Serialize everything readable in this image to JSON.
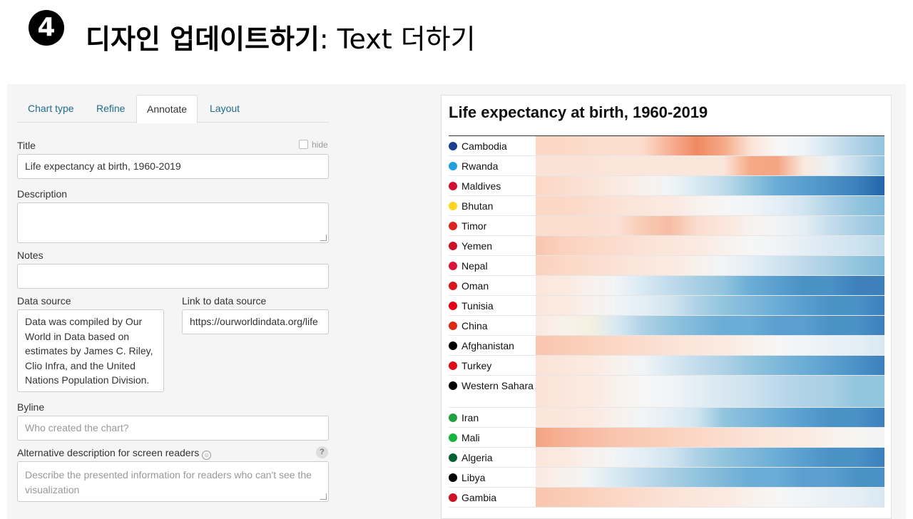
{
  "slide": {
    "step_number": "4",
    "title_bold": "디자인 업데이트하기",
    "title_rest": ": Text 더하기"
  },
  "editor": {
    "tabs": [
      {
        "label": "Chart type",
        "active": false
      },
      {
        "label": "Refine",
        "active": false
      },
      {
        "label": "Annotate",
        "active": true
      },
      {
        "label": "Layout",
        "active": false
      }
    ],
    "title_label": "Title",
    "hide_label": "hide",
    "title_value": "Life expectancy at birth, 1960-2019",
    "description_label": "Description",
    "description_value": "",
    "notes_label": "Notes",
    "notes_value": "",
    "data_source_label": "Data source",
    "data_source_value": "Data was compiled by Our World in Data based on estimates by James C. Riley, Clio Infra, and the United Nations Population Division.",
    "link_label": "Link to data source",
    "link_value": "https://ourworldindata.org/life",
    "byline_label": "Byline",
    "byline_placeholder": "Who created the chart?",
    "alt_label": "Alternative description for screen readers",
    "alt_placeholder": "Describe the presented information for readers who can't see the visualization",
    "help_glyph": "?"
  },
  "chart": {
    "title": "Life expectancy at birth, 1960-2019",
    "rows": [
      {
        "name": "Cambodia",
        "flag": "#1b3f94",
        "colors": [
          "#fbd7c6",
          "#fbd7c6",
          "#fbdccd",
          "#fbdccd",
          "#fbdccd",
          "#f7b095",
          "#ef8a62",
          "#f6a986",
          "#fbe3d6",
          "#f7f7f7",
          "#eef4f8",
          "#d1e5f0",
          "#b0d2e6",
          "#92c5de"
        ]
      },
      {
        "name": "Rwanda",
        "flag": "#20a0df",
        "colors": [
          "#fbe2d6",
          "#fbe2d6",
          "#fbe2d6",
          "#fbe6dc",
          "#fbe6dc",
          "#fbe6dc",
          "#fbe6dc",
          "#fbe6dc",
          "#f6a986",
          "#f4a582",
          "#fbe9df",
          "#e9f1f6",
          "#c4dcec",
          "#92c5de"
        ]
      },
      {
        "name": "Maldives",
        "flag": "#d21034",
        "colors": [
          "#fbd7c6",
          "#fbdccd",
          "#fbe2d6",
          "#fbe9df",
          "#f8f1ec",
          "#f1f4f6",
          "#d9e9f2",
          "#c0dbec",
          "#92c5de",
          "#6aadd6",
          "#5a9fcf",
          "#4a91c6",
          "#3d80bc",
          "#2166ac"
        ]
      },
      {
        "name": "Bhutan",
        "flag": "#ffd520",
        "colors": [
          "#fbd7c6",
          "#fbd7c6",
          "#fbdccd",
          "#fbe2d6",
          "#fbe6dc",
          "#fbe9df",
          "#f8f1ec",
          "#f6f6f6",
          "#f1f4f6",
          "#e4eef5",
          "#d1e5f0",
          "#b0d2e6",
          "#92c5de",
          "#7fb8da"
        ]
      },
      {
        "name": "Timor",
        "flag": "#dc241f",
        "colors": [
          "#fbdccd",
          "#fbdccd",
          "#fbdccd",
          "#fbe2d6",
          "#f9cbb5",
          "#f7bca3",
          "#fbdccd",
          "#fbe6dc",
          "#f7f2ee",
          "#f1f4f6",
          "#e4eef5",
          "#c4dcec",
          "#a9cfe4",
          "#92c5de"
        ]
      },
      {
        "name": "Yemen",
        "flag": "#ce1126",
        "colors": [
          "#f9c5ae",
          "#fbd1bd",
          "#fbd7c6",
          "#fbdccd",
          "#fbe2d6",
          "#fbe6dc",
          "#fbe9df",
          "#f8f1ec",
          "#f6f6f6",
          "#f1f4f6",
          "#e4eef5",
          "#d8e8f2",
          "#cde3ef",
          "#bdd9ea"
        ]
      },
      {
        "name": "Nepal",
        "flag": "#dc143c",
        "colors": [
          "#fbd1bd",
          "#fbd7c6",
          "#fbdccd",
          "#fbe2d6",
          "#fbe6dc",
          "#fbe9df",
          "#f8f1ec",
          "#f1f4f6",
          "#e4eef5",
          "#d1e5f0",
          "#bdd9ea",
          "#a9cfe4",
          "#92c5de",
          "#7fb8da"
        ]
      },
      {
        "name": "Oman",
        "flag": "#db161b",
        "colors": [
          "#fbe6dc",
          "#fbe9df",
          "#f8f1ec",
          "#f1f4f6",
          "#d9e9f2",
          "#c0dbec",
          "#a9cfe4",
          "#92c5de",
          "#6aadd6",
          "#5a9fcf",
          "#4a91c6",
          "#4a91c6",
          "#3d80bc",
          "#3d80bc"
        ]
      },
      {
        "name": "Tunisia",
        "flag": "#e70013",
        "colors": [
          "#fbe6dc",
          "#fbe9df",
          "#f8f1ec",
          "#f1f4f6",
          "#e4eef5",
          "#d1e5f0",
          "#b0d2e6",
          "#92c5de",
          "#7fb8da",
          "#6aadd6",
          "#5a9fcf",
          "#4a91c6",
          "#4a91c6",
          "#3d80bc"
        ]
      },
      {
        "name": "China",
        "flag": "#de2910",
        "colors": [
          "#fbe9df",
          "#f8f1ec",
          "#f6f0e0",
          "#d9e9f2",
          "#b0d2e6",
          "#92c5de",
          "#7fb8da",
          "#6aadd6",
          "#6aadd6",
          "#5a9fcf",
          "#5a9fcf",
          "#4a91c6",
          "#4a91c6",
          "#3d80bc"
        ]
      },
      {
        "name": "Afghanistan",
        "flag": "#000000",
        "colors": [
          "#f9c5ae",
          "#f9cbb5",
          "#fbd1bd",
          "#fbd7c6",
          "#fbdccd",
          "#fbe2d6",
          "#fbe6dc",
          "#fbe9df",
          "#f8f1ec",
          "#f6f6f6",
          "#f1f4f6",
          "#e9f1f6",
          "#e4eef5",
          "#d8e8f2"
        ]
      },
      {
        "name": "Turkey",
        "flag": "#e30a17",
        "colors": [
          "#fbe2d6",
          "#fbe6dc",
          "#fbe9df",
          "#f8f1ec",
          "#f1f4f6",
          "#d9e9f2",
          "#c4dcec",
          "#b0d2e6",
          "#92c5de",
          "#7fb8da",
          "#6aadd6",
          "#5a9fcf",
          "#4a91c6",
          "#3d80bc"
        ]
      },
      {
        "name": "Western Sahara",
        "flag": "#000000",
        "colors": [
          "#fbe2d6",
          "#fbe6dc",
          "#fbe9df",
          "#f8f1ec",
          "#f6f6f6",
          "#f1f4f6",
          "#e4eef5",
          "#d8e8f2",
          "#cde3ef",
          "#bdd9ea",
          "#b0d2e6",
          "#a9cfe4",
          "#92c5de",
          "#92c5de"
        ]
      },
      {
        "name": "Iran",
        "flag": "#239f40",
        "colors": [
          "#fbe6dc",
          "#fbe6dc",
          "#fbe9df",
          "#f8f1ec",
          "#f1f4f6",
          "#e4eef5",
          "#d1e5f0",
          "#92c5de",
          "#7fb8da",
          "#6aadd6",
          "#5a9fcf",
          "#4a91c6",
          "#4a91c6",
          "#3d80bc"
        ]
      },
      {
        "name": "Mali",
        "flag": "#14b53a",
        "colors": [
          "#f4a582",
          "#f7b095",
          "#f7bca3",
          "#f9c5ae",
          "#f9cbb5",
          "#fbd1bd",
          "#fbd7c6",
          "#fbdccd",
          "#fbe2d6",
          "#fbe6dc",
          "#fbe9df",
          "#f8f1ec",
          "#f6f6f0",
          "#f1f4f6"
        ]
      },
      {
        "name": "Algeria",
        "flag": "#006233",
        "colors": [
          "#fbe6dc",
          "#fbe9df",
          "#f8f1ec",
          "#f1f4f6",
          "#e4eef5",
          "#d1e5f0",
          "#b0d2e6",
          "#92c5de",
          "#7fb8da",
          "#6aadd6",
          "#5a9fcf",
          "#4a91c6",
          "#4a91c6",
          "#3d80bc"
        ]
      },
      {
        "name": "Libya",
        "flag": "#000000",
        "colors": [
          "#fbe9df",
          "#f8f1ec",
          "#f1f4f6",
          "#d9e9f2",
          "#c0dbec",
          "#a9cfe4",
          "#92c5de",
          "#7fb8da",
          "#6aadd6",
          "#6aadd6",
          "#5a9fcf",
          "#5a9fcf",
          "#4a91c6",
          "#4a91c6"
        ]
      },
      {
        "name": "Gambia",
        "flag": "#ce1126",
        "colors": [
          "#f9c5ae",
          "#f9cbb5",
          "#fbd1bd",
          "#fbd7c6",
          "#fbdccd",
          "#fbe2d6",
          "#fbe6dc",
          "#fbe9df",
          "#f8f1ec",
          "#f6f6f6",
          "#f1f4f6",
          "#e9f1f6",
          "#e4eef5",
          "#d8e8f2"
        ]
      }
    ]
  }
}
